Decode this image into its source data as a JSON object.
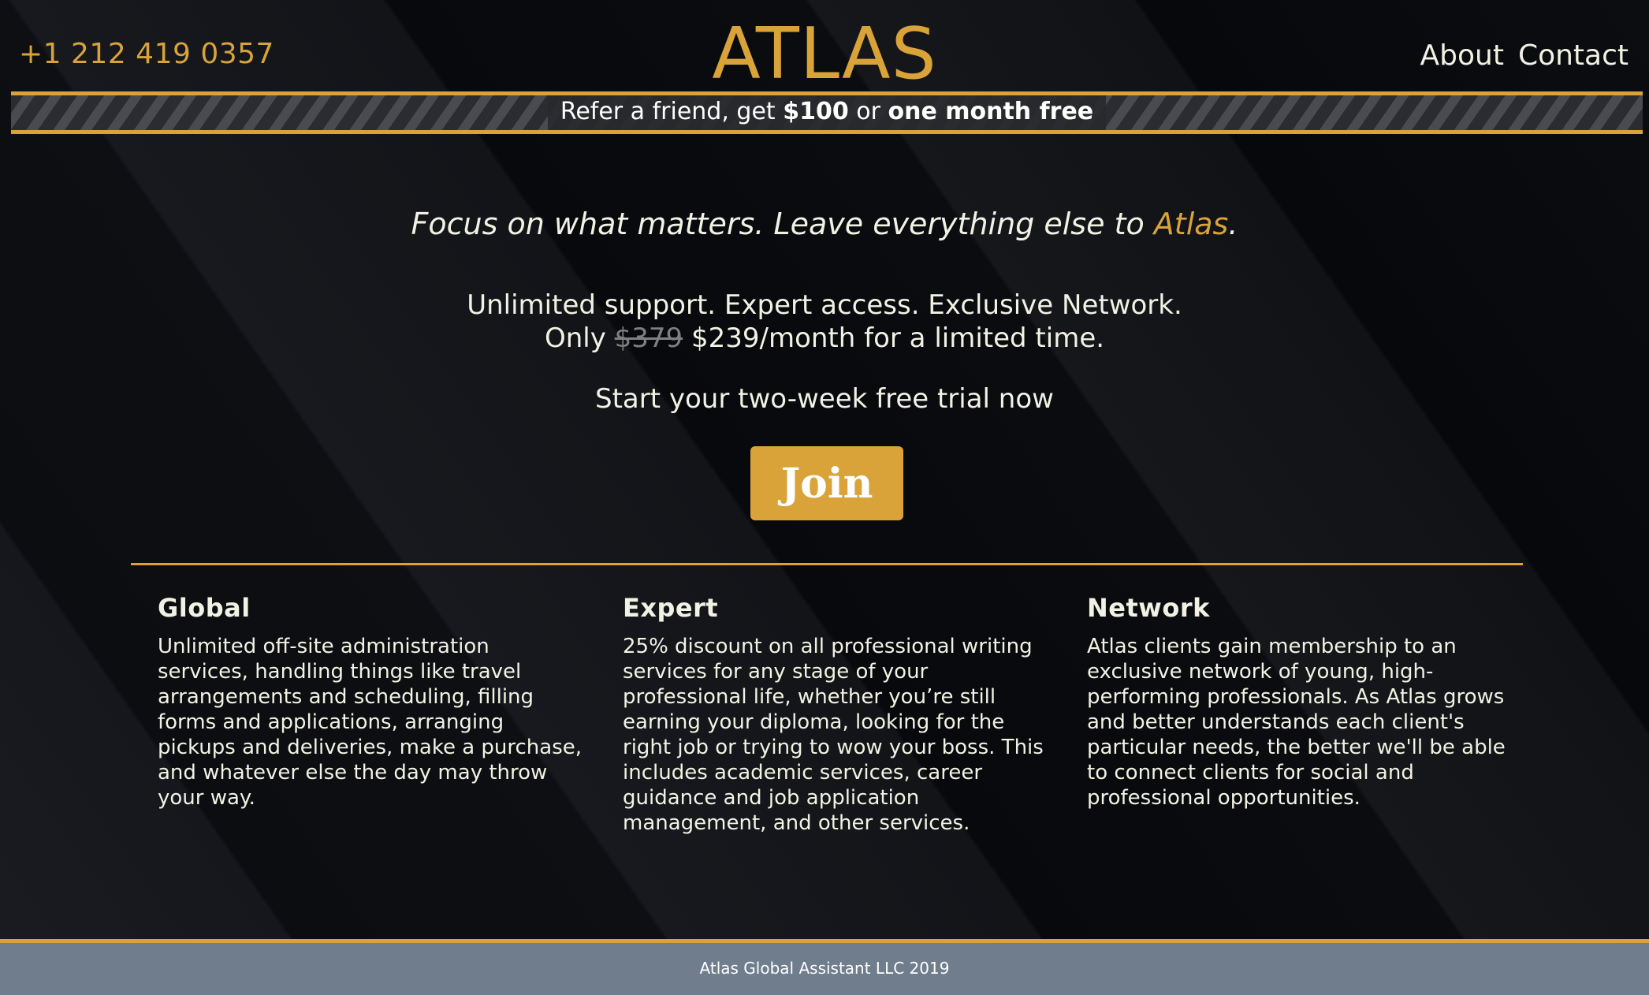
{
  "header": {
    "phone": "+1 212 419 0357",
    "brand": "ATLAS",
    "nav": {
      "about": "About",
      "contact": "Contact"
    }
  },
  "promo": {
    "prefix": "Refer a friend, get ",
    "amount": "$100",
    "or": " or ",
    "offer": "one month free"
  },
  "hero": {
    "tagline_main": "Focus on what matters. Leave everything else to ",
    "tagline_accent": "Atlas",
    "tagline_end": ".",
    "benefits_line1": "Unlimited support. Expert access. Exclusive Network.",
    "price_prefix": "Only ",
    "old_price": "$379",
    "new_price": " $239/month for a limited time.",
    "trial": "Start your two-week free trial now",
    "join_label": "Join"
  },
  "features": [
    {
      "title": "Global",
      "text": "Unlimited off-site administration services, handling things like travel arrangements and scheduling, filling forms and applications, arranging pickups and deliveries, make a purchase, and whatever else the day may throw your way."
    },
    {
      "title": "Expert",
      "text": "25% discount on all professional writing services for any stage of your professional life, whether you’re still earning your diploma, looking for the right job or trying to wow your boss. This includes academic services, career guidance and job application management, and other services."
    },
    {
      "title": "Network",
      "text": "Atlas clients gain membership to an exclusive network of young, high-performing professionals. As Atlas grows and better understands each client's particular needs, the better we'll be able to connect clients for social and professional opportunities."
    }
  ],
  "footer": {
    "text": "Atlas Global Assistant LLC 2019"
  },
  "colors": {
    "accent": "#d9a33a",
    "background": "#0a0c10",
    "footer": "#6f7d8d"
  }
}
